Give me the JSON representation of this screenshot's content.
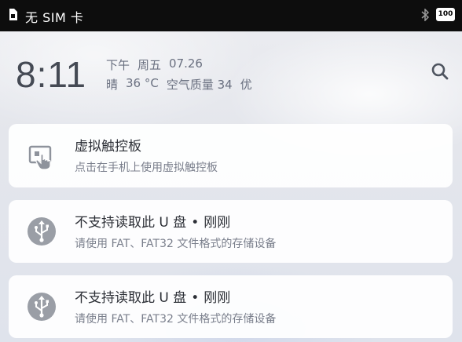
{
  "status_bar": {
    "carrier": "无 SIM 卡",
    "battery": "100",
    "sim_icon": "sim-card-icon",
    "bluetooth_icon": "bluetooth-icon"
  },
  "header": {
    "time": "8:11",
    "ampm": "下午",
    "weekday": "周五",
    "date": "07.26",
    "weather": "晴",
    "temperature": "36 °C",
    "air_quality_label": "空气质量 34",
    "air_quality_level": "优",
    "search_icon": "search-icon"
  },
  "notifications": [
    {
      "icon": "virtual-touchpad-icon",
      "title": "虚拟触控板",
      "subtitle": "点击在手机上使用虚拟触控板"
    },
    {
      "icon": "usb-icon",
      "title": "不支持读取此 U 盘",
      "separator": "•",
      "time": "刚刚",
      "subtitle": "请使用 FAT、FAT32 文件格式的存储设备"
    },
    {
      "icon": "usb-icon",
      "title": "不支持读取此 U 盘",
      "separator": "•",
      "time": "刚刚",
      "subtitle": "请使用 FAT、FAT32 文件格式的存储设备"
    }
  ]
}
